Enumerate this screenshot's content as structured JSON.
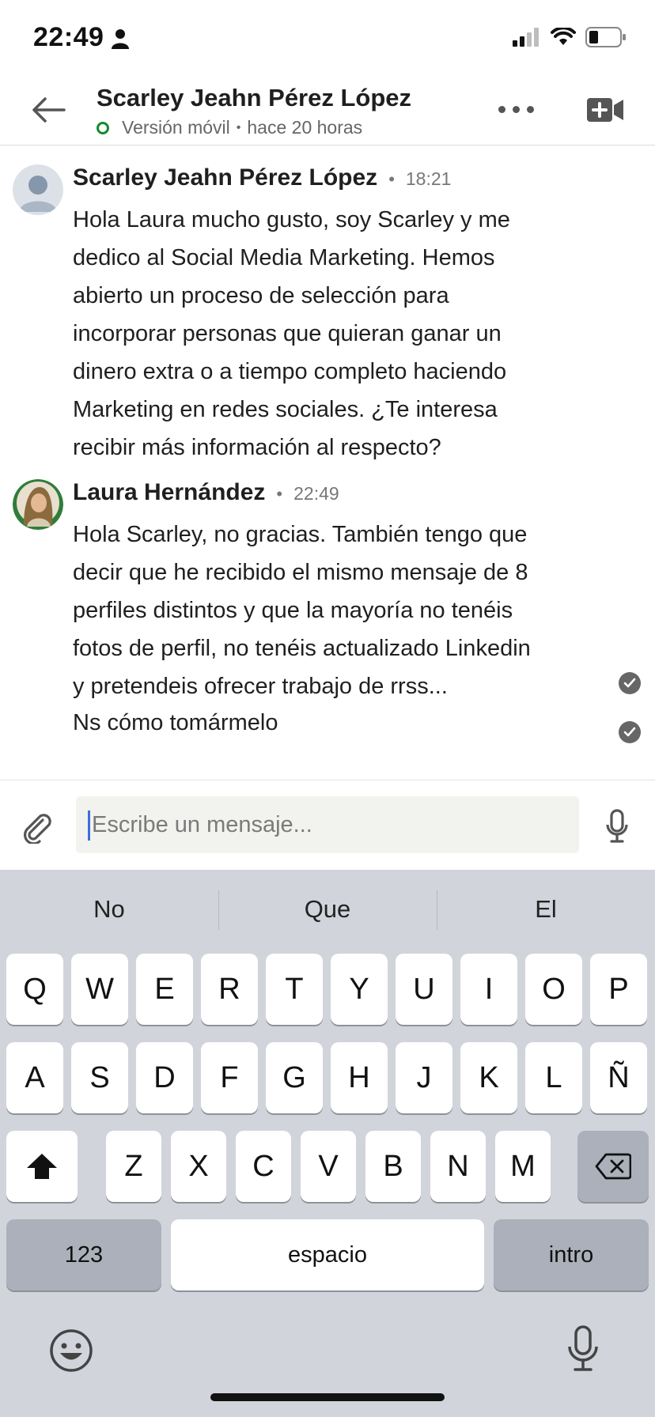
{
  "status_bar": {
    "time": "22:49"
  },
  "header": {
    "contact_name": "Scarley Jeahn Pérez López",
    "status_platform": "Versión móvil",
    "status_separator": "•",
    "status_last_seen": "hace 20 horas"
  },
  "messages": [
    {
      "sender": "Scarley Jeahn Pérez López",
      "separator": "•",
      "time": "18:21",
      "lines": [
        "Hola Laura mucho gusto, soy Scarley y me",
        "dedico al Social Media Marketing. Hemos",
        "abierto un proceso de selección para",
        "incorporar personas que quieran ganar un",
        "dinero extra o a tiempo completo haciendo",
        "Marketing en redes sociales. ¿Te interesa",
        "recibir más información al respecto?"
      ]
    },
    {
      "sender": "Laura Hernández",
      "separator": "•",
      "time": "22:49",
      "lines": [
        "Hola Scarley, no gracias. También tengo que",
        "decir que he recibido el mismo mensaje de 8",
        "perfiles distintos y que la mayoría no tenéis",
        "fotos de perfil, no tenéis actualizado Linkedin",
        "y pretendeis ofrecer trabajo de rrss..."
      ],
      "followup": "Ns cómo tomármelo"
    }
  ],
  "composer": {
    "placeholder": "Escribe un mensaje..."
  },
  "keyboard": {
    "suggestions": [
      "No",
      "Que",
      "El"
    ],
    "row1": [
      "Q",
      "W",
      "E",
      "R",
      "T",
      "Y",
      "U",
      "I",
      "O",
      "P"
    ],
    "row2": [
      "A",
      "S",
      "D",
      "F",
      "G",
      "H",
      "J",
      "K",
      "L",
      "Ñ"
    ],
    "row3": [
      "Z",
      "X",
      "C",
      "V",
      "B",
      "N",
      "M"
    ],
    "numbers_label": "123",
    "space_label": "espacio",
    "return_label": "intro"
  },
  "colors": {
    "online": "#178a2e",
    "caret": "#3a6fd8",
    "keyboard_bg": "#d1d4da"
  }
}
